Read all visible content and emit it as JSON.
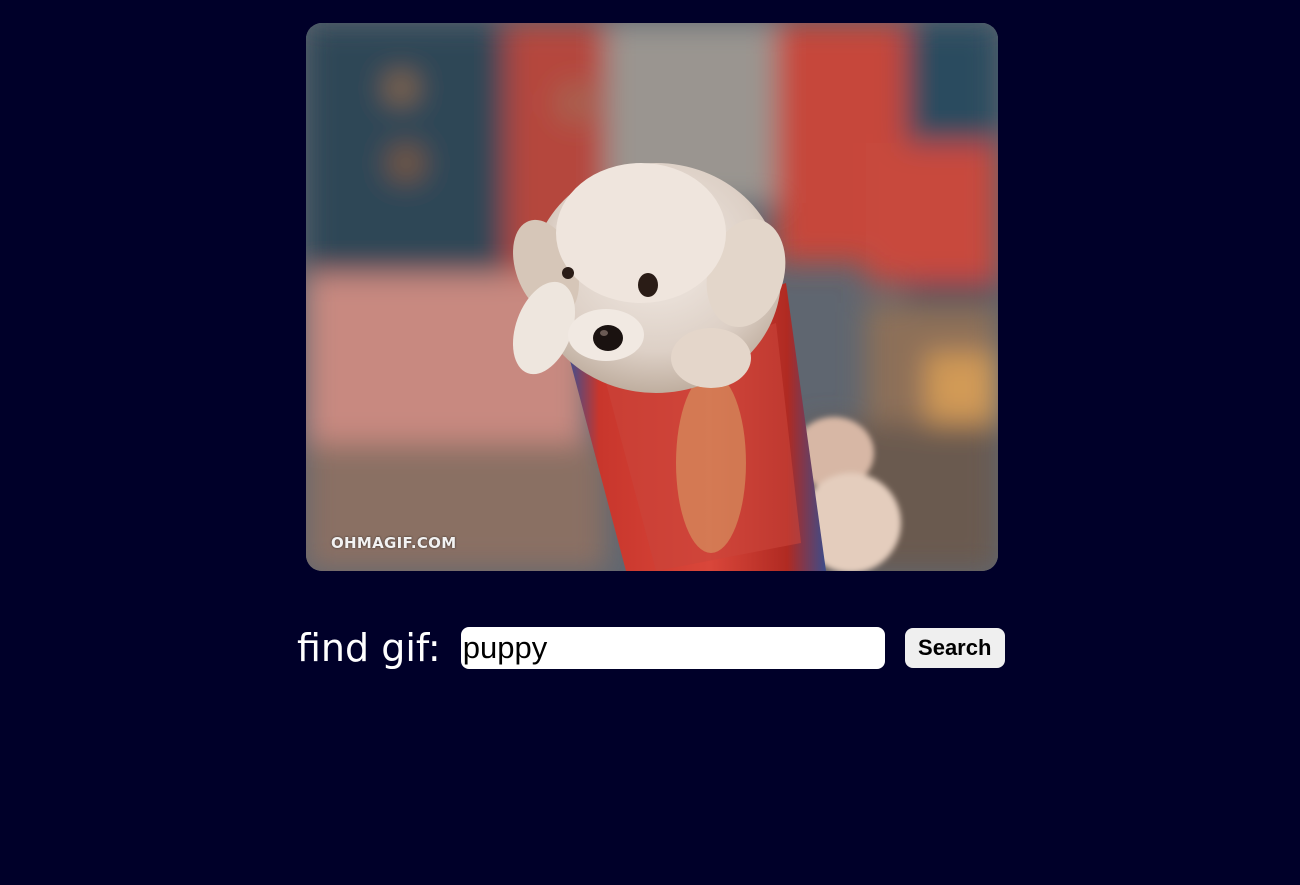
{
  "gif": {
    "watermark": "OHMAGIF.COM",
    "subject": "puppy-in-paper-cone"
  },
  "search": {
    "label": "find gif:",
    "value": "puppy",
    "button_label": "Search"
  },
  "colors": {
    "background": "#000029",
    "input_background": "#ffffff",
    "button_background": "#efefef",
    "label_text": "#ffffff"
  }
}
